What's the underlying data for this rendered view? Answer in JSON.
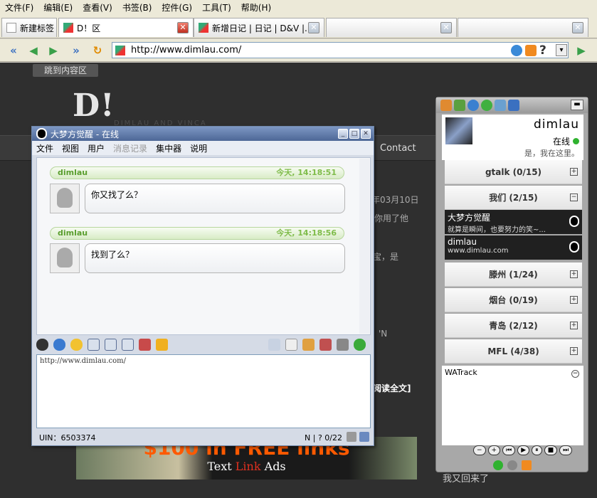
{
  "menu": [
    "文件(F)",
    "编辑(E)",
    "查看(V)",
    "书签(B)",
    "控件(G)",
    "工具(T)",
    "帮助(H)"
  ],
  "tabs": [
    {
      "label": "新建标签"
    },
    {
      "label": "D！区"
    },
    {
      "label": "新增日记 | 日记 | D&V |..."
    },
    {
      "label": ""
    },
    {
      "label": ""
    }
  ],
  "address": {
    "url": "http://www.dimlau.com/"
  },
  "page": {
    "skip": "跳到内容区",
    "logo": "D!",
    "logo_sub": "DIMLAU AND VINCA",
    "nav_contact": "Contact",
    "frag_date": "年03月10日",
    "frag_line1": "你用了他",
    "frag_line2": "宝，是",
    "frag_quote": "'N",
    "frag_more": "阅读全文]",
    "ad_big": "$100 in FREE links",
    "ad_small_a": "Text ",
    "ad_small_b": "Link",
    "ad_small_c": " Ads",
    "footer_text": "我又回来了"
  },
  "chat": {
    "title": "大梦方觉醒 - 在线",
    "menu": [
      "文件",
      "视图",
      "用户",
      "消息记录",
      "集中器",
      "说明"
    ],
    "messages": [
      {
        "sender": "dimlau",
        "time": "今天, 14:18:51",
        "text": "你又找了么？"
      },
      {
        "sender": "dimlau",
        "time": "今天, 14:18:56",
        "text": "找到了么？"
      }
    ],
    "input": "http://www.dimlau.com/",
    "uin": "UIN：6503374",
    "status": "N | ? 0/22"
  },
  "panel": {
    "user": "dimlau",
    "status": "在线",
    "signature": "是，我在这里。",
    "groups": [
      {
        "label": "gtalk (0/15)",
        "tog": "+"
      },
      {
        "label": "我们 (2/15)",
        "tog": "−"
      },
      {
        "label": "滕州 (1/24)",
        "tog": "+"
      },
      {
        "label": "烟台 (0/19)",
        "tog": "+"
      },
      {
        "label": "青岛 (2/12)",
        "tog": "+"
      },
      {
        "label": "MFL (4/38)",
        "tog": "+"
      }
    ],
    "contacts": [
      {
        "name": "大梦方觉醒",
        "note": "就算是瞬间，也要努力的笑~..."
      },
      {
        "name": "dimlau",
        "note": "www.dimlau.com"
      }
    ],
    "watrack": "WATrack",
    "player": [
      "−",
      "+",
      "⏮",
      "▶",
      "⏸",
      "■",
      "⏭"
    ]
  },
  "colors": {
    "accent": "#4d6796",
    "page_bg": "#2f2f2f",
    "online": "#2fb22f"
  }
}
